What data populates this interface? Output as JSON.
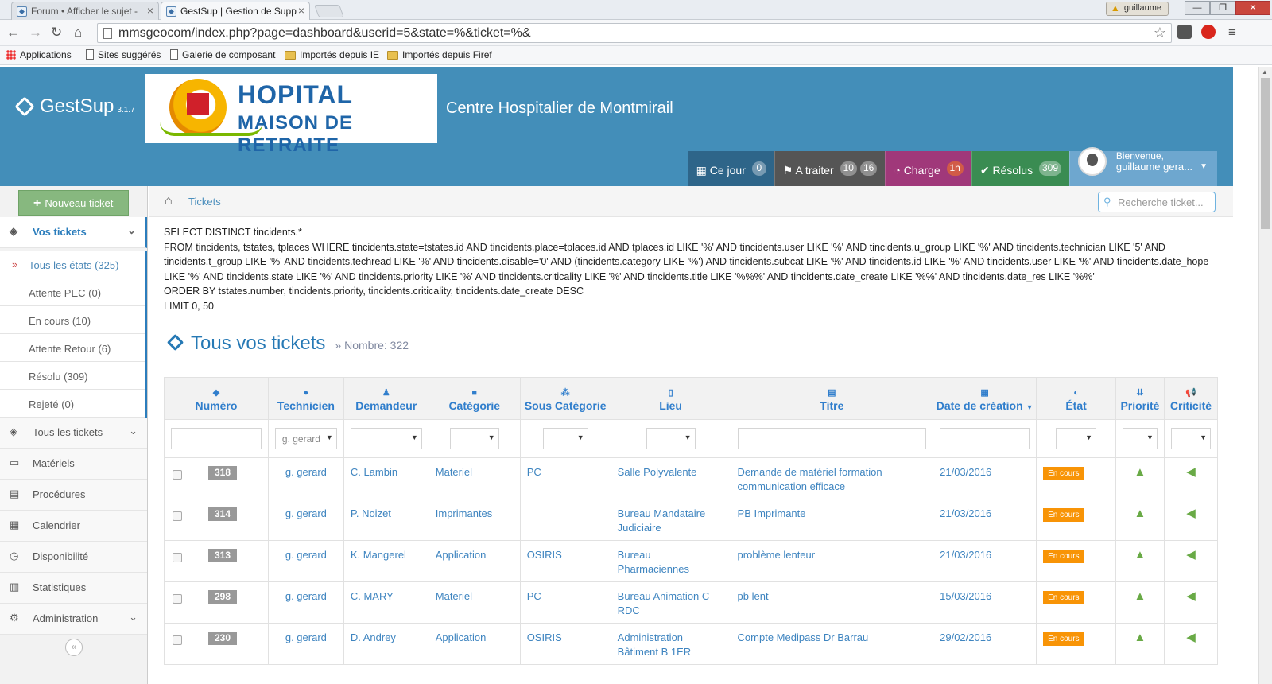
{
  "browser": {
    "tabs": [
      {
        "title": "Forum • Afficher le sujet -"
      },
      {
        "title": "GestSup | Gestion de Supp"
      }
    ],
    "window_user": "guillaume",
    "url": "mmsgeocom/index.php?page=dashboard&userid=5&state=%&ticket=%&",
    "bookmarks": [
      "Applications",
      "Sites suggérés",
      "Galerie de composant",
      "Importés depuis IE",
      "Importés depuis Firef"
    ]
  },
  "header": {
    "app_name": "GestSup",
    "version": "3.1.7",
    "logo_line1": "HOPITAL",
    "logo_line2": "MAISON DE RETRAITE",
    "center_name": "Centre Hospitalier de Montmirail",
    "buttons": {
      "today": {
        "label": "Ce jour",
        "badge": "0"
      },
      "todo": {
        "label": "A traiter",
        "badge1": "10",
        "badge2": "16"
      },
      "charge": {
        "label": "Charge",
        "badge": "1h"
      },
      "resolved": {
        "label": "Résolus",
        "badge": "309"
      }
    },
    "user": {
      "greeting": "Bienvenue,",
      "name": "guillaume gera..."
    }
  },
  "sidebar": {
    "new_ticket": "Nouveau ticket",
    "my_tickets": "Vos tickets",
    "states": [
      "Tous les états (325)",
      "Attente PEC (0)",
      "En cours (10)",
      "Attente Retour (6)",
      "Résolu (309)",
      "Rejeté (0)"
    ],
    "items": [
      "Tous les tickets",
      "Matériels",
      "Procédures",
      "Calendrier",
      "Disponibilité",
      "Statistiques",
      "Administration"
    ]
  },
  "breadcrumb": "Tickets",
  "search_placeholder": "Recherche ticket...",
  "sql": {
    "l1": "SELECT DISTINCT tincidents.*",
    "l2": "FROM tincidents, tstates, tplaces WHERE tincidents.state=tstates.id AND tincidents.place=tplaces.id AND tplaces.id LIKE '%' AND tincidents.user LIKE '%' AND tincidents.u_group LIKE '%' AND tincidents.technician LIKE '5' AND tincidents.t_group LIKE '%' AND tincidents.techread LIKE '%' AND tincidents.disable='0' AND (tincidents.category LIKE '%') AND tincidents.subcat LIKE '%' AND tincidents.id LIKE '%' AND tincidents.user LIKE '%' AND tincidents.date_hope LIKE '%' AND tincidents.state LIKE '%' AND tincidents.priority LIKE '%' AND tincidents.criticality LIKE '%' AND tincidents.title LIKE '%%%' AND tincidents.date_create LIKE '%%' AND tincidents.date_res LIKE '%%'",
    "l3": "ORDER BY tstates.number, tincidents.priority, tincidents.criticality, tincidents.date_create DESC",
    "l4": "LIMIT 0, 50"
  },
  "page": {
    "title": "Tous vos tickets",
    "count_label": "Nombre: 322"
  },
  "table": {
    "headers": [
      "Numéro",
      "Technicien",
      "Demandeur",
      "Catégorie",
      "Sous Catégorie",
      "Lieu",
      "Titre",
      "Date de création",
      "État",
      "Priorité",
      "Criticité"
    ],
    "tech_filter": "g. gerard",
    "rows": [
      {
        "num": "318",
        "tech": "g. gerard",
        "req": "C. Lambin",
        "cat": "Materiel",
        "subcat": "PC",
        "place": "Salle Polyvalente",
        "title": "Demande de matériel formation communication efficace",
        "date": "21/03/2016",
        "state": "En cours"
      },
      {
        "num": "314",
        "tech": "g. gerard",
        "req": "P. Noizet",
        "cat": "Imprimantes",
        "subcat": "",
        "place": "Bureau Mandataire Judiciaire",
        "title": "PB Imprimante",
        "date": "21/03/2016",
        "state": "En cours"
      },
      {
        "num": "313",
        "tech": "g. gerard",
        "req": "K. Mangerel",
        "cat": "Application",
        "subcat": "OSIRIS",
        "place": "Bureau Pharmaciennes",
        "title": "problème lenteur",
        "date": "21/03/2016",
        "state": "En cours"
      },
      {
        "num": "298",
        "tech": "g. gerard",
        "req": "C. MARY",
        "cat": "Materiel",
        "subcat": "PC",
        "place": "Bureau Animation C RDC",
        "title": "pb lent",
        "date": "15/03/2016",
        "state": "En cours"
      },
      {
        "num": "230",
        "tech": "g. gerard",
        "req": "D. Andrey",
        "cat": "Application",
        "subcat": "OSIRIS",
        "place": "Administration Bâtiment B 1ER",
        "title": "Compte Medipass Dr Barrau",
        "date": "29/02/2016",
        "state": "En cours"
      }
    ]
  }
}
